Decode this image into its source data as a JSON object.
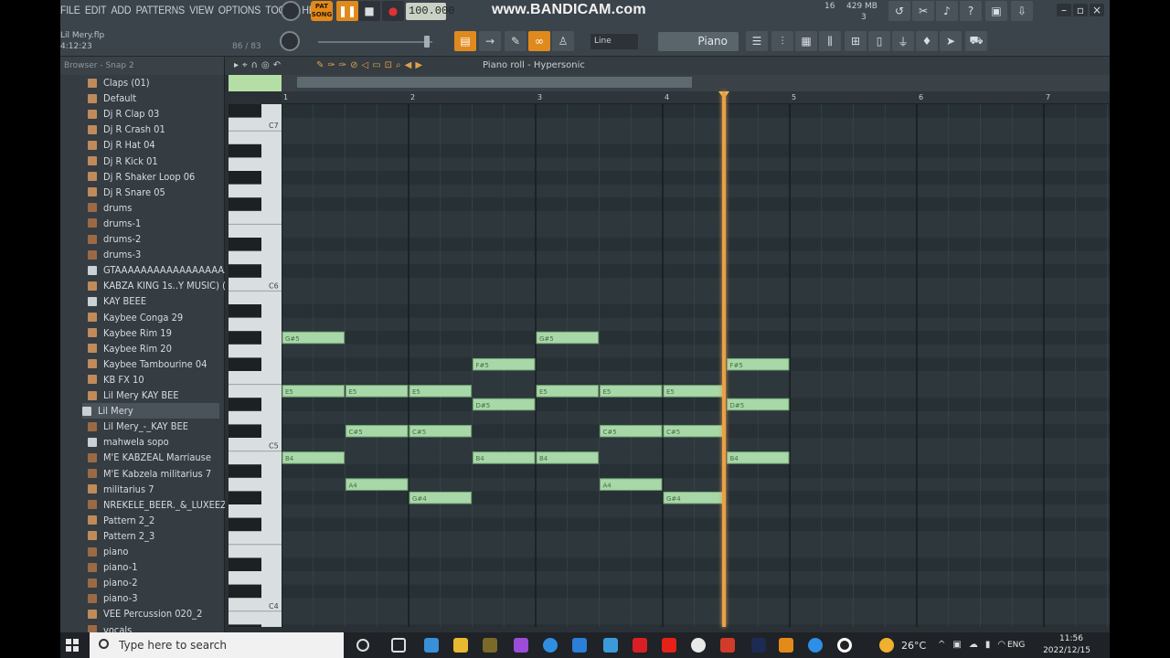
{
  "menu": [
    "FILE",
    "EDIT",
    "ADD",
    "PATTERNS",
    "VIEW",
    "OPTIONS",
    "TOOLS",
    "HELP"
  ],
  "project": {
    "name": "Lil Mery.flp",
    "time": "4:12:23",
    "fraction": "86 / 83"
  },
  "transport": {
    "pat_label_top": "PAT",
    "pat_label_bottom": "SONG",
    "tempo": "100.000"
  },
  "watermark": "www.BANDICAM.com",
  "perf": {
    "cpu": "16",
    "memory": "429 MB",
    "voices": "3"
  },
  "snap_mode": "Line",
  "instrument": "Piano",
  "browser": {
    "header": "Browser - Snap 2",
    "items": [
      {
        "label": "Claps (01)",
        "icon": "folder"
      },
      {
        "label": "Default",
        "icon": "folder"
      },
      {
        "label": "Dj R Clap 03",
        "icon": "folder"
      },
      {
        "label": "Dj R Crash 01",
        "icon": "folder"
      },
      {
        "label": "Dj R Hat 04",
        "icon": "folder"
      },
      {
        "label": "Dj R Kick 01",
        "icon": "folder"
      },
      {
        "label": "Dj R Shaker Loop 06",
        "icon": "folder"
      },
      {
        "label": "Dj R Snare 05",
        "icon": "folder"
      },
      {
        "label": "drums",
        "icon": "audio"
      },
      {
        "label": "drums-1",
        "icon": "audio"
      },
      {
        "label": "drums-2",
        "icon": "audio"
      },
      {
        "label": "drums-3",
        "icon": "audio"
      },
      {
        "label": "GTAAAAAAAAAAAAAAAAAAA",
        "icon": "file"
      },
      {
        "label": "KABZA KING 1s..Y MUSIC) (31)",
        "icon": "folder"
      },
      {
        "label": "KAY BEEE",
        "icon": "file"
      },
      {
        "label": "Kaybee Conga 29",
        "icon": "folder"
      },
      {
        "label": "Kaybee Rim 19",
        "icon": "folder"
      },
      {
        "label": "Kaybee Rim 20",
        "icon": "folder"
      },
      {
        "label": "Kaybee Tambourine 04",
        "icon": "folder"
      },
      {
        "label": "KB FX 10",
        "icon": "folder"
      },
      {
        "label": "Lil Mery KAY BEE",
        "icon": "folder"
      },
      {
        "label": "Lil Mery",
        "icon": "file",
        "active": true
      },
      {
        "label": "Lil Mery_-_KAY BEE",
        "icon": "audio"
      },
      {
        "label": "mahwela sopo",
        "icon": "file"
      },
      {
        "label": "M'E KABZEAL Marriause",
        "icon": "audio"
      },
      {
        "label": "M'E Kabzela militarius 7",
        "icon": "audio"
      },
      {
        "label": "militarius 7",
        "icon": "folder"
      },
      {
        "label": "NREKELE_BEER._&_LUXEEZ_SA",
        "icon": "audio"
      },
      {
        "label": "Pattern 2_2",
        "icon": "folder"
      },
      {
        "label": "Pattern 2_3",
        "icon": "folder"
      },
      {
        "label": "piano",
        "icon": "audio"
      },
      {
        "label": "piano-1",
        "icon": "audio"
      },
      {
        "label": "piano-2",
        "icon": "audio"
      },
      {
        "label": "piano-3",
        "icon": "audio"
      },
      {
        "label": "VEE Percussion 020_2",
        "icon": "folder"
      },
      {
        "label": "vocals",
        "icon": "audio"
      }
    ]
  },
  "piano_roll": {
    "title": "Piano roll - Hypersonic",
    "bars": [
      "1",
      "2",
      "3",
      "4",
      "5",
      "6",
      "7"
    ],
    "octave_labels": [
      "C7",
      "C6",
      "C5",
      "C4"
    ],
    "playhead_beat": 13.94,
    "notes": [
      {
        "pitch": "G#5",
        "start": 0,
        "length": 2
      },
      {
        "pitch": "E5",
        "start": 0,
        "length": 2
      },
      {
        "pitch": "B4",
        "start": 0,
        "length": 2
      },
      {
        "pitch": "E5",
        "start": 2,
        "length": 2
      },
      {
        "pitch": "C#5",
        "start": 2,
        "length": 2
      },
      {
        "pitch": "A4",
        "start": 2,
        "length": 2
      },
      {
        "pitch": "E5",
        "start": 4,
        "length": 2
      },
      {
        "pitch": "C#5",
        "start": 4,
        "length": 2
      },
      {
        "pitch": "G#4",
        "start": 4,
        "length": 2
      },
      {
        "pitch": "F#5",
        "start": 6,
        "length": 2
      },
      {
        "pitch": "D#5",
        "start": 6,
        "length": 2
      },
      {
        "pitch": "B4",
        "start": 6,
        "length": 2
      },
      {
        "pitch": "G#5",
        "start": 8,
        "length": 2
      },
      {
        "pitch": "E5",
        "start": 8,
        "length": 2
      },
      {
        "pitch": "B4",
        "start": 8,
        "length": 2
      },
      {
        "pitch": "E5",
        "start": 10,
        "length": 2
      },
      {
        "pitch": "C#5",
        "start": 10,
        "length": 2
      },
      {
        "pitch": "A4",
        "start": 10,
        "length": 2
      },
      {
        "pitch": "E5",
        "start": 12,
        "length": 2
      },
      {
        "pitch": "C#5",
        "start": 12,
        "length": 2
      },
      {
        "pitch": "G#4",
        "start": 12,
        "length": 2
      },
      {
        "pitch": "F#5",
        "start": 14,
        "length": 2
      },
      {
        "pitch": "D#5",
        "start": 14,
        "length": 2
      },
      {
        "pitch": "B4",
        "start": 14,
        "length": 2
      }
    ]
  },
  "taskbar": {
    "search_placeholder": "Type here to search",
    "temperature": "26°C",
    "language": "ENG",
    "time": "11:56",
    "date": "2022/12/15"
  },
  "colors": {
    "note_fill": "#a8d8a8",
    "note_border": "#6fa070",
    "accent": "#e08a1e",
    "playhead": "#e8a04a"
  }
}
